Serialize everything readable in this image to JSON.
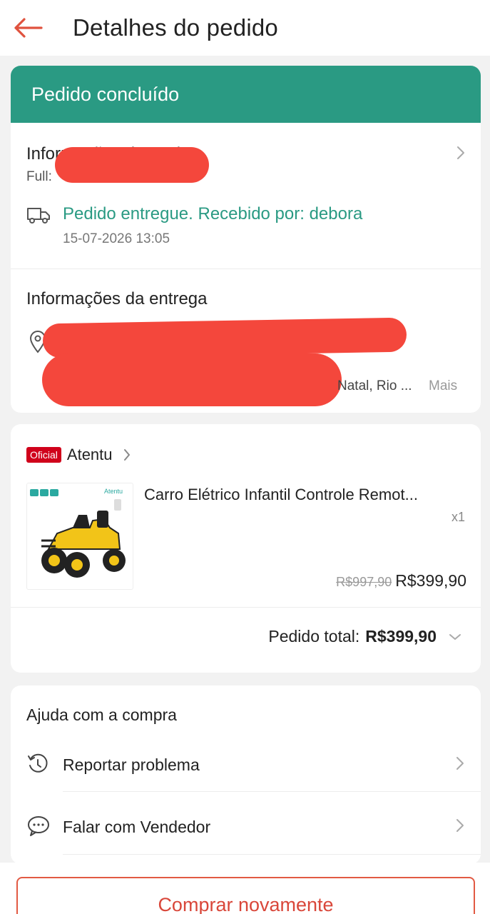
{
  "header": {
    "title": "Detalhes do pedido",
    "back_icon": "arrow-left-icon",
    "accent": "#e0523e"
  },
  "status": {
    "label": "Pedido concluído",
    "color": "#2a9a83"
  },
  "shipping": {
    "title": "Informações do envio",
    "name_prefix": "Full:",
    "status_text": "Pedido entregue. Recebido por: debora",
    "date": "15-07-2026 13:05",
    "icon": "truck-icon"
  },
  "delivery": {
    "title": "Informações da entrega",
    "address_end": "Natal, Rio ...",
    "more_label": "Mais",
    "icon": "location-pin-icon"
  },
  "product": {
    "official_badge": "Oficial",
    "shop_name": "Atentu",
    "name": "Carro Elétrico Infantil Controle Remot...",
    "quantity": "x1",
    "original_price": "R$997,90",
    "price": "R$399,90",
    "total_label": "Pedido total:",
    "total_value": "R$399,90",
    "thumb_brand": "Atentu"
  },
  "help": {
    "title": "Ajuda com a compra",
    "items": [
      {
        "label": "Reportar problema",
        "icon": "report-problem-icon"
      },
      {
        "label": "Falar com Vendedor",
        "icon": "chat-bubbles-icon"
      }
    ]
  },
  "footer": {
    "buy_again_label": "Comprar novamente",
    "accent": "#d9473a"
  }
}
